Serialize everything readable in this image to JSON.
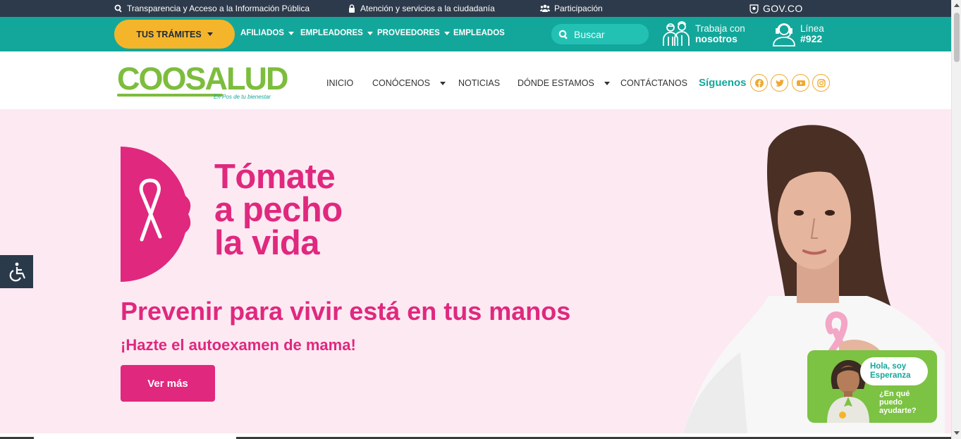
{
  "govbar": {
    "transparencia": "Transparencia y Acceso a la Información Pública",
    "atencion": "Atención y servicios a la ciudadanía",
    "participacion": "Participación",
    "gov": "GOV.CO"
  },
  "tealbar": {
    "tramites": "TUS TRÁMITES",
    "items": [
      "AFILIADOS",
      "EMPLEADORES",
      "PROVEEDORES",
      "EMPLEADOS"
    ],
    "search_placeholder": "Buscar",
    "trabaja_l1": "Trabaja con",
    "trabaja_l2": "nosotros",
    "linea_l1": "Línea",
    "linea_l2": "#922"
  },
  "header": {
    "logo": "COOSALUD",
    "logo_tag": "En Pos de tu bienestar",
    "nav": [
      "INICIO",
      "CONÓCENOS",
      "NOTICIAS",
      "DÓNDE ESTAMOS",
      "CONTÁCTANOS"
    ],
    "siguenos": "Síguenos"
  },
  "hero": {
    "title": [
      "Tómate",
      "a pecho",
      "la vida"
    ],
    "subtitle": "Prevenir para vivir está en tus manos",
    "subtitle2": "¡Hazte el autoexamen de mama!",
    "button": "Ver más"
  },
  "chat": {
    "greeting_l1": "Hola, soy",
    "greeting_l2": "Esperanza",
    "q1": "¿En qué",
    "q2": "puedo",
    "q3": "ayudarte?"
  },
  "colors": {
    "teal": "#13a79b",
    "pink": "#e0287e",
    "yellow": "#f5b52a",
    "green": "#7dbd3d",
    "dark": "#2d3a4b"
  },
  "icons": [
    "search-icon",
    "lock-icon",
    "people-icon",
    "facebook-icon",
    "twitter-icon",
    "youtube-icon",
    "instagram-icon",
    "wheelchair-icon",
    "ribbon-icon"
  ]
}
